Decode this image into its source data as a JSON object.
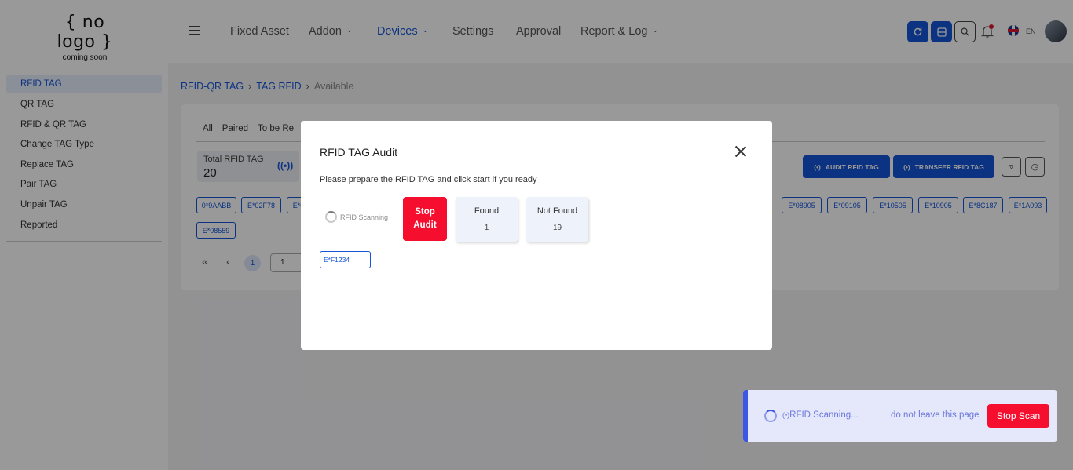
{
  "header": {
    "logo_main": "{ no logo }",
    "logo_sub": "coming soon",
    "nav": [
      "Fixed Asset",
      "Addon",
      "Devices",
      "Settings",
      "Approval",
      "Report & Log"
    ],
    "lang": "EN"
  },
  "sidebar": {
    "items": [
      "RFID TAG",
      "QR TAG",
      "RFID & QR TAG",
      "Change TAG Type",
      "Replace TAG",
      "Pair TAG",
      "Unpair TAG",
      "Reported"
    ]
  },
  "breadcrumb": {
    "part1": "RFID-QR TAG",
    "part2": "TAG RFID",
    "part3": "Available"
  },
  "tabs": [
    "All",
    "Paired",
    "To be Re"
  ],
  "stat": {
    "label": "Total RFID TAG",
    "value": "20"
  },
  "actions": {
    "audit": "AUDIT RFID TAG",
    "transfer": "TRANSFER RFID TAG"
  },
  "chips_left": [
    "0*9AABB",
    "E*02F78",
    "E*0"
  ],
  "chips_right": [
    "E*08905",
    "E*09105",
    "E*10505",
    "E*10905",
    "E*8C187",
    "E*1A093"
  ],
  "chip_row2": "E*08559",
  "pagination": {
    "current": "1",
    "input": "1"
  },
  "modal": {
    "title": "RFID TAG Audit",
    "message": "Please prepare the RFID TAG and click start if you ready",
    "scanning": "RFID Scanning",
    "stop_label": "Stop Audit",
    "found_label": "Found",
    "found_value": "1",
    "notfound_label": "Not Found",
    "notfound_value": "19",
    "found_tag": "E*F1234"
  },
  "toast": {
    "scanning": "RFID Scanning...",
    "warning": "do not leave this page",
    "stop_label": "Stop Scan"
  },
  "colors": {
    "primary": "#1455d9",
    "danger": "#f50e2d",
    "toast_accent": "#3d56e6"
  }
}
